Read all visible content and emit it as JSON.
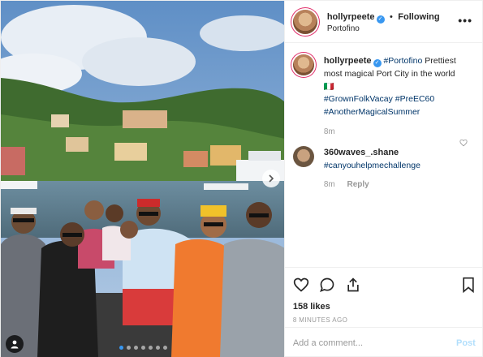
{
  "post": {
    "header": {
      "username": "hollyrpeete",
      "verified_mark": "✓",
      "separator": "•",
      "follow_label": "Following",
      "location": "Portofino",
      "more_icon": "more-horizontal-icon",
      "more_label": "•••"
    },
    "caption": {
      "username": "hollyrpeete",
      "location_tag": "#Portofino",
      "text": " Prettiest most magical Port City in the world",
      "emoji": "🇮🇹",
      "hashtags": [
        "#GrownFolkVacay",
        "#PreEC60",
        "#AnotherMagicalSummer"
      ],
      "age": "8m"
    },
    "comments": [
      {
        "username": "360waves_.shane",
        "text": "#canyouhelpmechallenge",
        "age": "8m",
        "reply_label": "Reply"
      }
    ],
    "actions": {
      "like_icon": "heart-icon",
      "comment_icon": "comment-icon",
      "share_icon": "share-icon",
      "save_icon": "bookmark-icon"
    },
    "likes": "158 likes",
    "timestamp": "8 MINUTES AGO",
    "add_comment": {
      "placeholder": "Add a comment...",
      "post_label": "Post"
    },
    "carousel": {
      "total": 7,
      "active": 1
    },
    "colors": {
      "accent": "#3897f0",
      "hashtag": "#003569",
      "muted": "#999999",
      "post_disabled": "#b2dffc"
    }
  }
}
